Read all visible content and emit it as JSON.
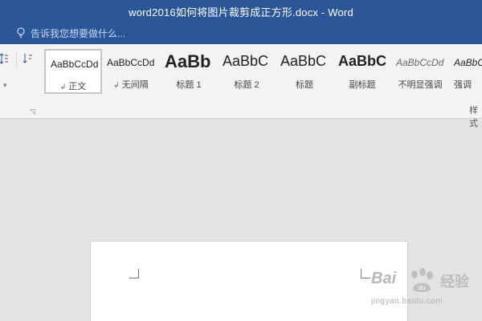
{
  "window": {
    "title": "word2016如何将图片裁剪成正方形.docx - Word",
    "tell_me_placeholder": "告诉我您想要做什么..."
  },
  "styles_gallery": {
    "group_label": "样式",
    "items": [
      {
        "preview": "AaBbCcDd",
        "label": "正文",
        "paragraph_mark": "↲",
        "selected": true
      },
      {
        "preview": "AaBbCcDd",
        "label": "无间隔",
        "paragraph_mark": "↲"
      },
      {
        "preview": "AaBb",
        "label": "标题 1"
      },
      {
        "preview": "AaBbC",
        "label": "标题 2"
      },
      {
        "preview": "AaBbC",
        "label": "标题"
      },
      {
        "preview": "AaBbC",
        "label": "副标题"
      },
      {
        "preview": "AaBbCcDd",
        "label": "不明显强调"
      },
      {
        "preview": "AaBbCcDd",
        "label": "强调"
      }
    ]
  },
  "watermark": {
    "brand": "Bai",
    "brand_cn": "经验",
    "url": "jingyan.baidu.com"
  },
  "colors": {
    "titlebar": "#2b579a",
    "ribbon": "#f3f3f3",
    "workspace": "#e3e3e3",
    "page": "#ffffff"
  }
}
